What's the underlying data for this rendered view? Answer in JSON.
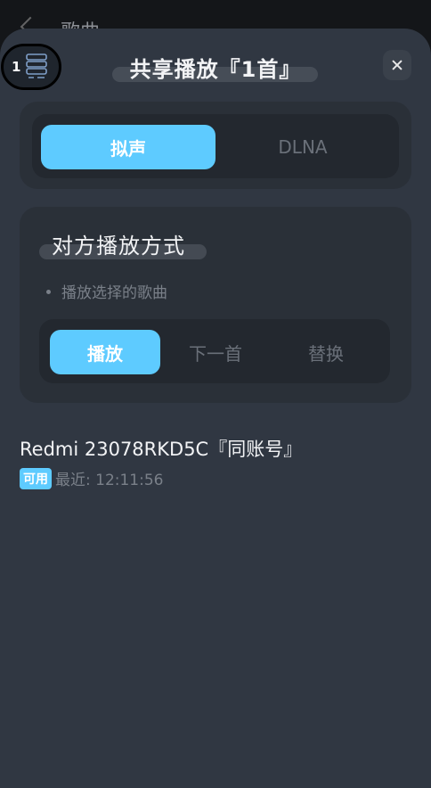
{
  "background": {
    "title": "歌曲"
  },
  "badge": {
    "count": "1"
  },
  "sheet": {
    "title": "共享播放『1首』"
  },
  "mode": {
    "options": [
      "拟声",
      "DLNA"
    ],
    "selected": "拟声"
  },
  "playback": {
    "title": "对方播放方式",
    "note": "播放选择的歌曲",
    "options": [
      "播放",
      "下一首",
      "替换"
    ],
    "selected": "播放"
  },
  "device": {
    "name": "Redmi 23078RKD5C『同账号』",
    "status": "可用",
    "last_seen": "最近: 12:11:56"
  },
  "colors": {
    "accent": "#5ecbff",
    "sheet": "#303742",
    "card": "#2a3038"
  }
}
